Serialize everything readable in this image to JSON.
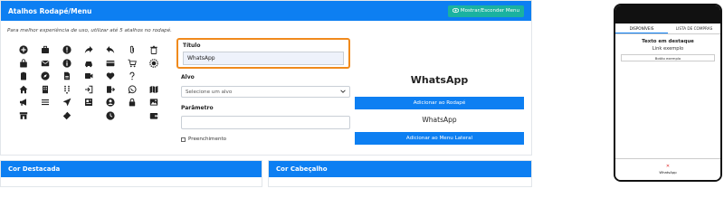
{
  "header": {
    "title": "Atalhos Rodapé/Menu",
    "toggle_label": "Mostrar/Esconder Menu"
  },
  "intro": "Para melhor experiência de uso, utilizar até 5 atalhos no rodapé.",
  "icons": [
    "plus-circle-icon",
    "briefcase-icon",
    "alert-circle-icon",
    "share-icon",
    "reply-icon",
    "paperclip-icon",
    "trash-icon",
    "bag-icon",
    "mail-icon",
    "info-circle-icon",
    "car-icon",
    "credit-card-icon",
    "cart-icon",
    "badge-icon",
    "clipboard-icon",
    "compass-icon",
    "document-icon",
    "film-icon",
    "heart-icon",
    "question-icon",
    "home-icon",
    "building-icon",
    "dialpad-icon",
    "login-icon",
    "logout-icon",
    "whatsapp-icon",
    "map-icon",
    "megaphone-icon",
    "menu-icon",
    "send-icon",
    "news-icon",
    "user-circle-icon",
    "lock-icon",
    "gallery-icon",
    "store-icon",
    "ticket-icon",
    "clock-icon",
    "wallet-icon"
  ],
  "form": {
    "title_label": "Título",
    "title_value": "WhatsApp",
    "target_label": "Alvo",
    "target_placeholder": "Selecione um alvo",
    "param_label": "Parâmetro",
    "fill_label": "Preenchimento"
  },
  "preview": {
    "title": "WhatsApp",
    "add_footer_label": "Adicionar ao Rodapé",
    "text": "WhatsApp",
    "add_menu_label": "Adicionar ao Menu Lateral"
  },
  "cards": {
    "highlight_color": "Cor Destacada",
    "header_color": "Cor Cabeçalho"
  },
  "phone": {
    "tabs": [
      "DISPONÍVEIS",
      "LISTA DE COMPRAS"
    ],
    "title": "Texto em destaque",
    "link": "Link exemplo",
    "button": "Botão exemplo",
    "footer_close": "✕",
    "footer_label": "WhatsApp"
  },
  "colors": {
    "primary": "#0d7ff2",
    "teal": "#1ab2a0",
    "highlight": "#f08a1c"
  }
}
